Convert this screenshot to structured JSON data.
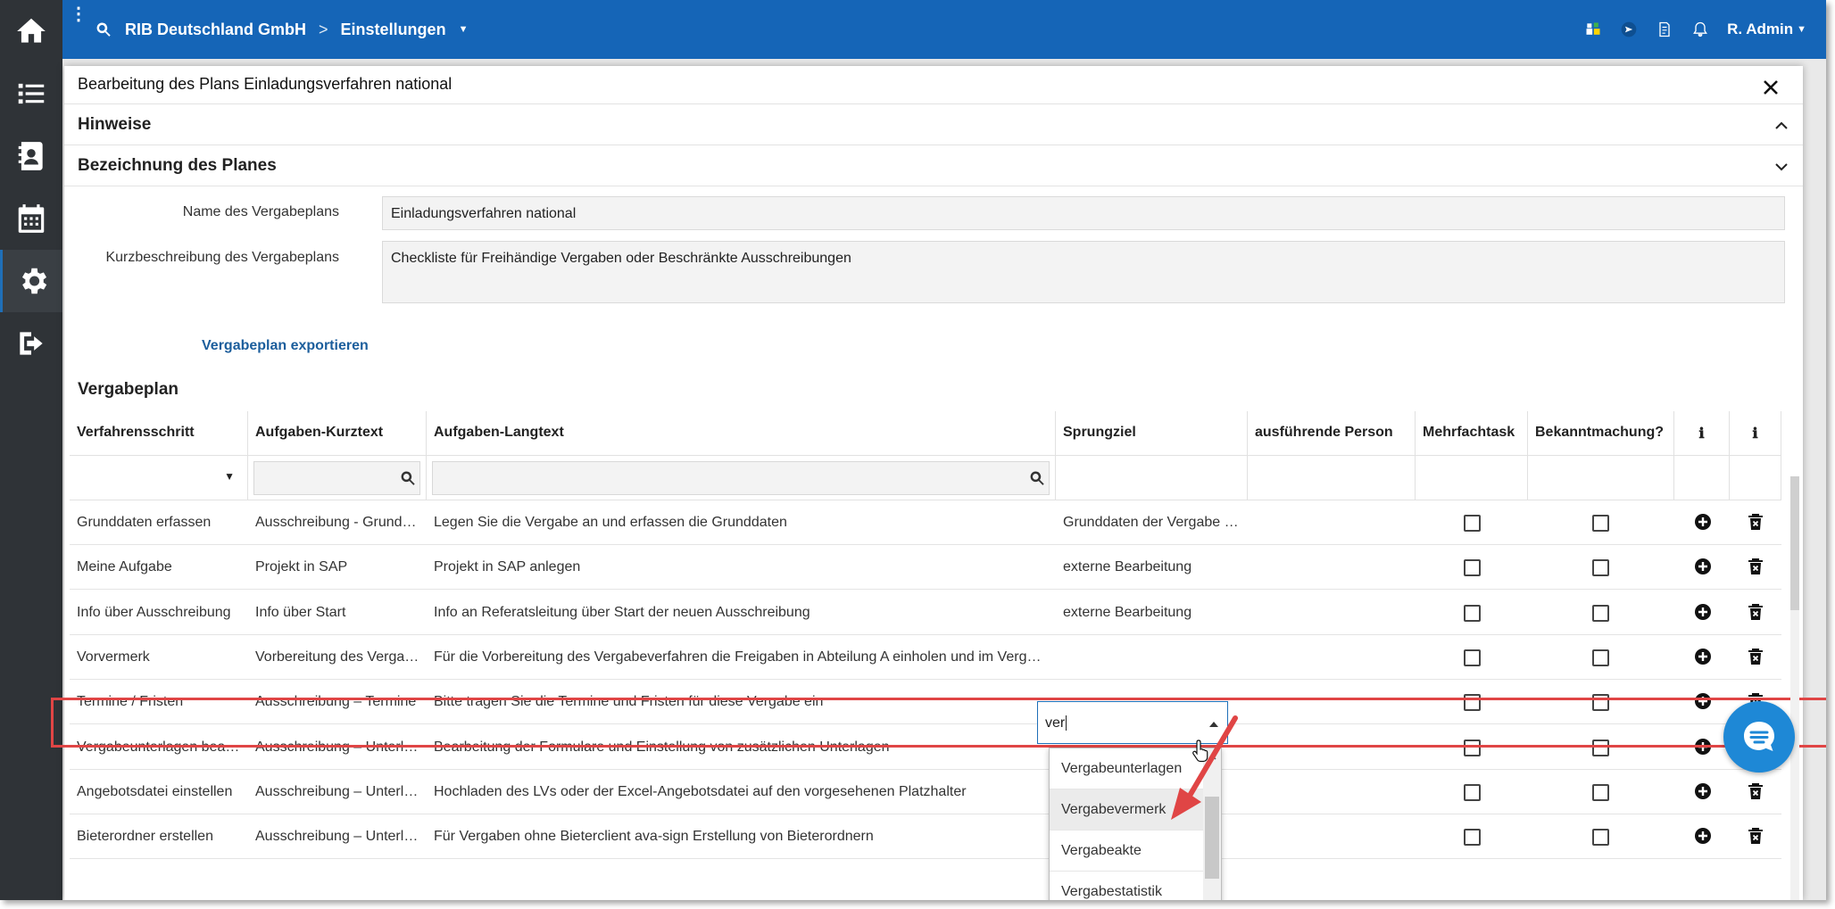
{
  "topbar": {
    "company": "RIB Deutschland GmbH",
    "separator": ">",
    "section": "Einstellungen",
    "user": "R. Admin"
  },
  "sidebar": {
    "items": [
      {
        "icon": "home-icon"
      },
      {
        "icon": "list-icon"
      },
      {
        "icon": "contacts-icon"
      },
      {
        "icon": "calendar-icon"
      },
      {
        "icon": "gear-icon",
        "active": true
      },
      {
        "icon": "logout-icon"
      }
    ]
  },
  "modal": {
    "title": "Bearbeitung des Plans Einladungsverfahren national",
    "sections": {
      "hints": "Hinweise",
      "plan_name": "Bezeichnung des Planes"
    },
    "form": {
      "name_label": "Name des Vergabeplans",
      "name_value": "Einladungsverfahren national",
      "desc_label": "Kurzbeschreibung des Vergabeplans",
      "desc_value": "Checkliste für Freihändige Vergaben oder Beschränkte Ausschreibungen"
    },
    "export_link": "Vergabeplan exportieren",
    "plan_title": "Vergabeplan"
  },
  "table": {
    "headers": {
      "step": "Verfahrensschritt",
      "short": "Aufgaben-Kurztext",
      "long": "Aufgaben-Langtext",
      "target": "Sprungziel",
      "person": "ausführende Person",
      "multi": "Mehrfachtask",
      "notice": "Bekanntmachung?",
      "info1": "ℹ",
      "info2": "ℹ"
    },
    "rows": [
      {
        "step": "Grunddaten erfassen",
        "short": "Ausschreibung - Grunddaten",
        "long": "Legen Sie die Vergabe an und erfassen die Grunddaten",
        "target": "Grunddaten der Vergabe erfassen"
      },
      {
        "step": "Meine Aufgabe",
        "short": "Projekt in SAP",
        "long": "Projekt in SAP anlegen",
        "target": "externe Bearbeitung"
      },
      {
        "step": "Info über Ausschreibung",
        "short": "Info über Start",
        "long": "Info an Referatsleitung über Start der neuen Ausschreibung",
        "target": "externe Bearbeitung"
      },
      {
        "step": "Vorvermerk",
        "short": "Vorbereitung des Vergabeverfahrens",
        "long": "Für die Vorbereitung des Vergabeverfahren die Freigaben in Abteilung A einholen und im Vergabevermerk",
        "target": ""
      },
      {
        "step": "Termine / Fristen",
        "short": "Ausschreibung – Termine",
        "long": "Bitte tragen Sie die Termine und Fristen für diese Vergabe ein",
        "target": ""
      },
      {
        "step": "Vergabeunterlagen bearbeiten",
        "short": "Ausschreibung – Unterlagen",
        "long": "Bearbeitung der Formulare und Einstellung von zusätzlichen Unterlagen",
        "target": ""
      },
      {
        "step": "Angebotsdatei einstellen",
        "short": "Ausschreibung – Unterlagen",
        "long": "Hochladen des LVs oder der Excel-Angebotsdatei auf den vorgesehenen Platzhalter",
        "target": ""
      },
      {
        "step": "Bieterordner erstellen",
        "short": "Ausschreibung – Unterlagen",
        "long": "Für Vergaben ohne Bieterclient ava-sign Erstellung von Bieterordnern",
        "target": ""
      }
    ]
  },
  "combo": {
    "value": "ver",
    "options": [
      "Vergabeunterlagen",
      "Vergabevermerk",
      "Vergabeakte",
      "Vergabestatistik"
    ],
    "hovered_index": 1
  },
  "colors": {
    "topbar": "#1565b7",
    "sidebar": "#2f3337",
    "highlight": "#e04545",
    "link": "#1c5e9c",
    "chat": "#1e88d6"
  }
}
